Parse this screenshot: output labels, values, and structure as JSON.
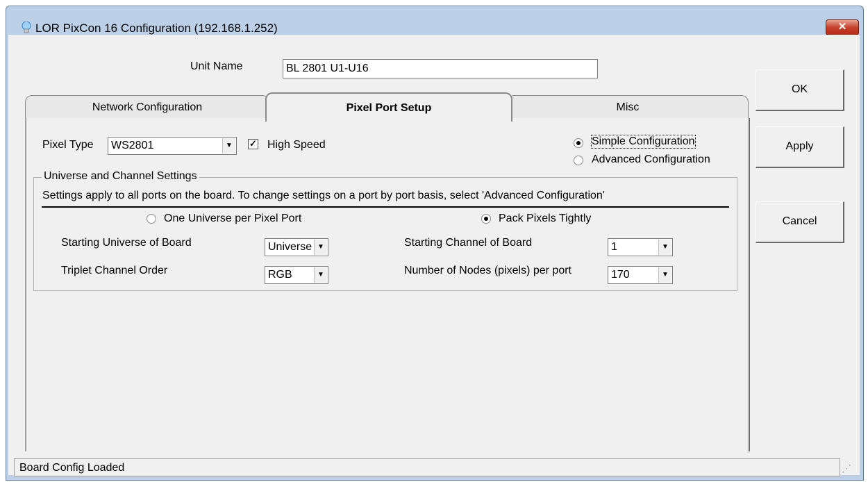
{
  "window": {
    "title": "LOR PixCon 16 Configuration (192.168.1.252)",
    "close_label": "✕"
  },
  "unit_name": {
    "label": "Unit Name",
    "value": "BL 2801 U1-U16"
  },
  "buttons": {
    "ok": "OK",
    "apply": "Apply",
    "cancel": "Cancel"
  },
  "tabs": [
    {
      "label": "Network Configuration",
      "active": false
    },
    {
      "label": "Pixel Port Setup",
      "active": true
    },
    {
      "label": "Misc",
      "active": false
    }
  ],
  "pixel_type": {
    "label": "Pixel Type",
    "value": "WS2801"
  },
  "high_speed": {
    "label": "High Speed",
    "checked": true
  },
  "config_mode": {
    "simple": "Simple Configuration",
    "advanced": "Advanced Configuration",
    "selected": "simple"
  },
  "universe_group": {
    "title": "Universe and Channel Settings",
    "info": "Settings apply to all ports on the board.  To change settings on a port by port basis, select 'Advanced Configuration'",
    "one_universe": "One Universe per Pixel Port",
    "pack_pixels": "Pack Pixels Tightly",
    "starting_universe_label": "Starting Universe of Board",
    "starting_universe_value": "Universe",
    "triplet_order_label": "Triplet Channel Order",
    "triplet_order_value": "RGB",
    "starting_channel_label": "Starting Channel of Board",
    "starting_channel_value": "1",
    "nodes_label": "Number of Nodes (pixels) per port",
    "nodes_value": "170"
  },
  "status": "Board Config Loaded",
  "colors": {
    "titlebar": "#bcd1e8",
    "close": "#c8412b",
    "dialog_bg": "#f0f0f0"
  }
}
